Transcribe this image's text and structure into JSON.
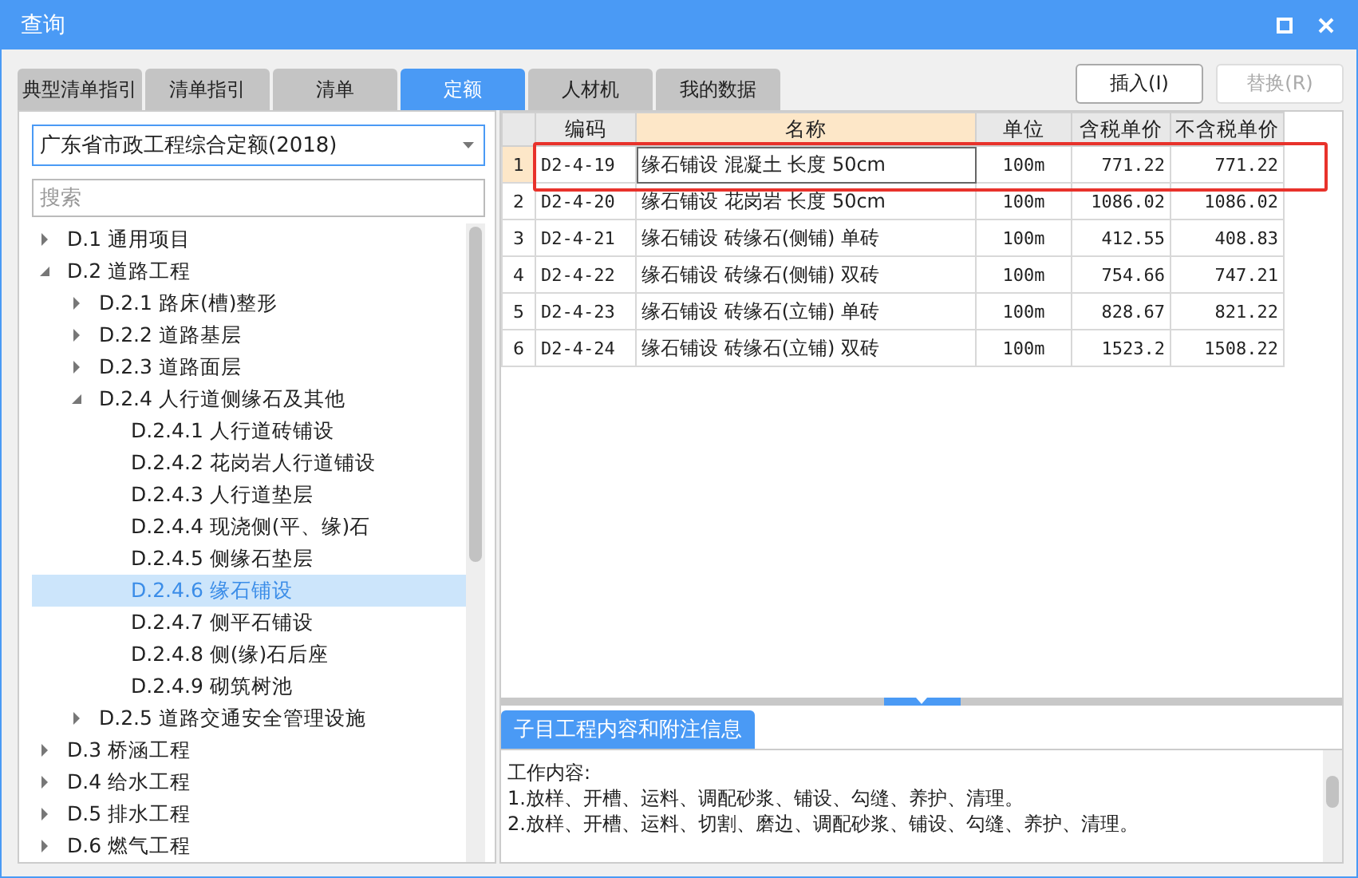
{
  "window": {
    "title": "查询"
  },
  "tabs": [
    {
      "label": "典型清单指引",
      "selected": false
    },
    {
      "label": "清单指引",
      "selected": false
    },
    {
      "label": "清单",
      "selected": false
    },
    {
      "label": "定额",
      "selected": true
    },
    {
      "label": "人材机",
      "selected": false
    },
    {
      "label": "我的数据",
      "selected": false
    }
  ],
  "buttons": [
    {
      "label": "插入(I)",
      "disabled": false
    },
    {
      "label": "替换(R)",
      "disabled": true
    }
  ],
  "library_select": {
    "value": "广东省市政工程综合定额(2018)"
  },
  "search": {
    "placeholder": "搜索"
  },
  "tree": [
    {
      "label": "D.1 通用项目",
      "expanded": false,
      "selected": false
    },
    {
      "label": "D.2 道路工程",
      "expanded": true,
      "selected": false,
      "children": [
        {
          "label": "D.2.1 路床(槽)整形",
          "expanded": false,
          "selected": false
        },
        {
          "label": "D.2.2 道路基层",
          "expanded": false,
          "selected": false
        },
        {
          "label": "D.2.3 道路面层",
          "expanded": false,
          "selected": false
        },
        {
          "label": "D.2.4 人行道侧缘石及其他",
          "expanded": true,
          "selected": false,
          "children": [
            {
              "label": "D.2.4.1 人行道砖铺设",
              "selected": false
            },
            {
              "label": "D.2.4.2 花岗岩人行道铺设",
              "selected": false
            },
            {
              "label": "D.2.4.3 人行道垫层",
              "selected": false
            },
            {
              "label": "D.2.4.4 现浇侧(平、缘)石",
              "selected": false
            },
            {
              "label": "D.2.4.5 侧缘石垫层",
              "selected": false
            },
            {
              "label": "D.2.4.6 缘石铺设",
              "selected": true
            },
            {
              "label": "D.2.4.7 侧平石铺设",
              "selected": false
            },
            {
              "label": "D.2.4.8 侧(缘)石后座",
              "selected": false
            },
            {
              "label": "D.2.4.9 砌筑树池",
              "selected": false
            }
          ]
        },
        {
          "label": "D.2.5 道路交通安全管理设施",
          "expanded": false,
          "selected": false
        }
      ]
    },
    {
      "label": "D.3 桥涵工程",
      "expanded": false,
      "selected": false
    },
    {
      "label": "D.4 给水工程",
      "expanded": false,
      "selected": false
    },
    {
      "label": "D.5 排水工程",
      "expanded": false,
      "selected": false
    },
    {
      "label": "D.6 燃气工程",
      "expanded": false,
      "selected": false
    }
  ],
  "table": {
    "columns": [
      {
        "label": "编码",
        "selected": false
      },
      {
        "label": "名称",
        "selected": true
      },
      {
        "label": "单位",
        "selected": false
      },
      {
        "label": "含税单价",
        "selected": false
      },
      {
        "label": "不含税单价",
        "selected": false
      }
    ],
    "rows": [
      {
        "index": "1",
        "selected": true,
        "cells": [
          "D2-4-19",
          "缘石铺设 混凝土 长度 50cm",
          "100m",
          "771.22",
          "771.22"
        ]
      },
      {
        "index": "2",
        "selected": false,
        "cells": [
          "D2-4-20",
          "缘石铺设 花岗岩 长度 50cm",
          "100m",
          "1086.02",
          "1086.02"
        ]
      },
      {
        "index": "3",
        "selected": false,
        "cells": [
          "D2-4-21",
          "缘石铺设 砖缘石(侧铺) 单砖",
          "100m",
          "412.55",
          "408.83"
        ]
      },
      {
        "index": "4",
        "selected": false,
        "cells": [
          "D2-4-22",
          "缘石铺设 砖缘石(侧铺) 双砖",
          "100m",
          "754.66",
          "747.21"
        ]
      },
      {
        "index": "5",
        "selected": false,
        "cells": [
          "D2-4-23",
          "缘石铺设 砖缘石(立铺) 单砖",
          "100m",
          "828.67",
          "821.22"
        ]
      },
      {
        "index": "6",
        "selected": false,
        "cells": [
          "D2-4-24",
          "缘石铺设 砖缘石(立铺) 双砖",
          "100m",
          "1523.2",
          "1508.22"
        ]
      }
    ]
  },
  "detail": {
    "tab": "子目工程内容和附注信息",
    "lines": [
      "工作内容:",
      "1.放样、开槽、运料、调配砂浆、铺设、勾缝、养护、清理。",
      "2.放样、开槽、运料、切割、磨边、调配砂浆、铺设、勾缝、养护、清理。"
    ]
  }
}
